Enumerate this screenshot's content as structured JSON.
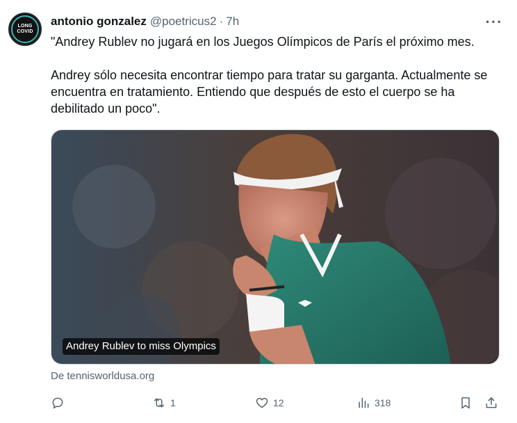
{
  "author": {
    "name": "antonio gonzalez",
    "handle": "@poetricus2",
    "separator": "·",
    "time": "7h",
    "avatar_line1": "LONG",
    "avatar_line2": "COVID"
  },
  "tweet": {
    "paragraph1": "\"Andrey Rublev no jugará en los Juegos Olímpicos de París el próximo mes.",
    "paragraph2": "Andrey sólo necesita encontrar tiempo para tratar su garganta. Actualmente se encuentra en tratamiento. Entiendo que después de esto el cuerpo se ha debilitado un poco\"."
  },
  "card": {
    "title": "Andrey Rublev to miss Olympics",
    "source": "De tennisworldusa.org"
  },
  "actions": {
    "reply_count": "",
    "retweet_count": "1",
    "like_count": "12",
    "views_count": "318"
  },
  "colors": {
    "text": "#0f1419",
    "secondary": "#536471",
    "border": "#cfd9de"
  }
}
